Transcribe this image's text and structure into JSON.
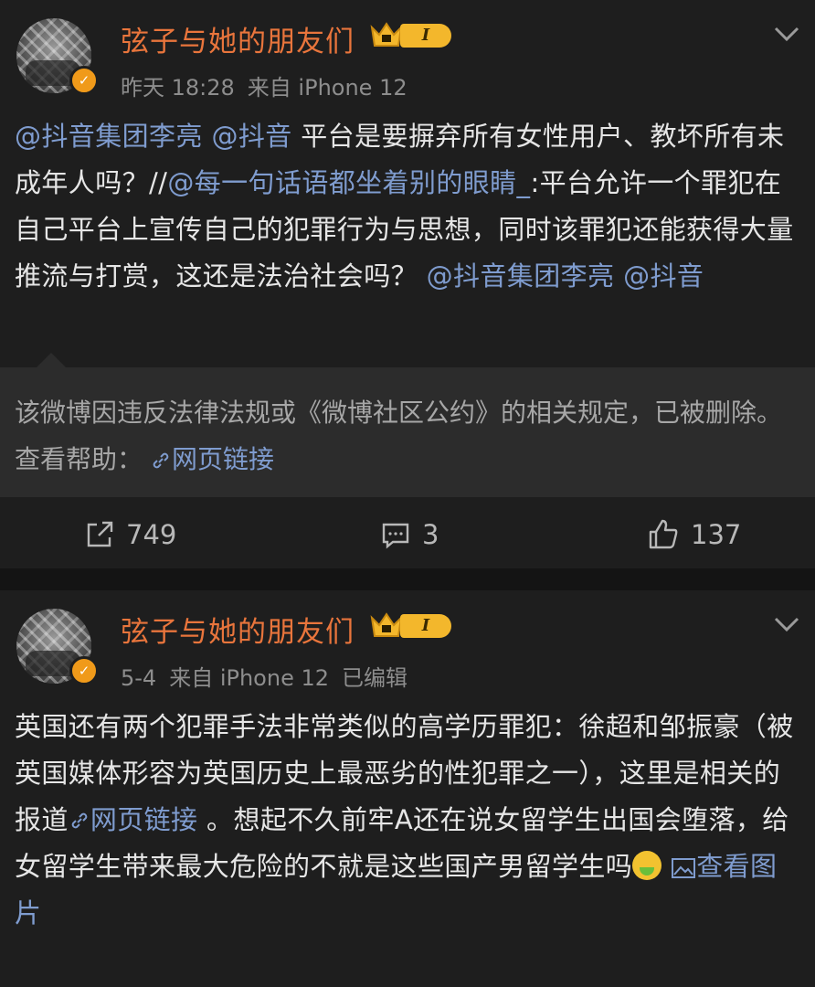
{
  "posts": [
    {
      "author": "弦子与她的朋友们",
      "level": "I",
      "time": "昨天 18:28",
      "source": "来自 iPhone 12",
      "content": {
        "mention1": "@抖音集团李亮",
        "mention2": "@抖音",
        "text1": " 平台是要摒弃所有女性用户、教坏所有未成年人吗？//",
        "mention3": "@每一句话语都坐着别的眼睛_",
        "text2": ":平台允许一个罪犯在自己平台上宣传自己的犯罪行为与思想，同时该罪犯还能获得大量推流与打赏，这还是法治社会吗？",
        "mention4": "@抖音集团李亮",
        "mention5": "@抖音"
      },
      "repost": {
        "notice": "该微博因违反法律法规或《微博社区公约》的相关规定，已被删除。查看帮助：",
        "link": "网页链接"
      },
      "actions": {
        "reposts": "749",
        "comments": "3",
        "likes": "137"
      }
    },
    {
      "author": "弦子与她的朋友们",
      "level": "I",
      "time": "5-4",
      "source": "来自 iPhone 12",
      "edited": "已编辑",
      "content": {
        "text1": "英国还有两个犯罪手法非常类似的高学历罪犯：徐超和邹振豪（被英国媒体形容为英国历史上最恶劣的性犯罪之一），这里是相关的报道",
        "link": "网页链接",
        "text2": " 。想起不久前牢A还在说女留学生出国会堕落，给女留学生带来最大危险的不就是这些国产男留学生吗",
        "emoji": "nauseated-face-emoji",
        "image_link": "查看图片"
      }
    }
  ],
  "colors": {
    "username": "#e9753c",
    "mention": "#7f9ccf",
    "vip_badge": "#f3b72c",
    "verified": "#f09a1a"
  }
}
